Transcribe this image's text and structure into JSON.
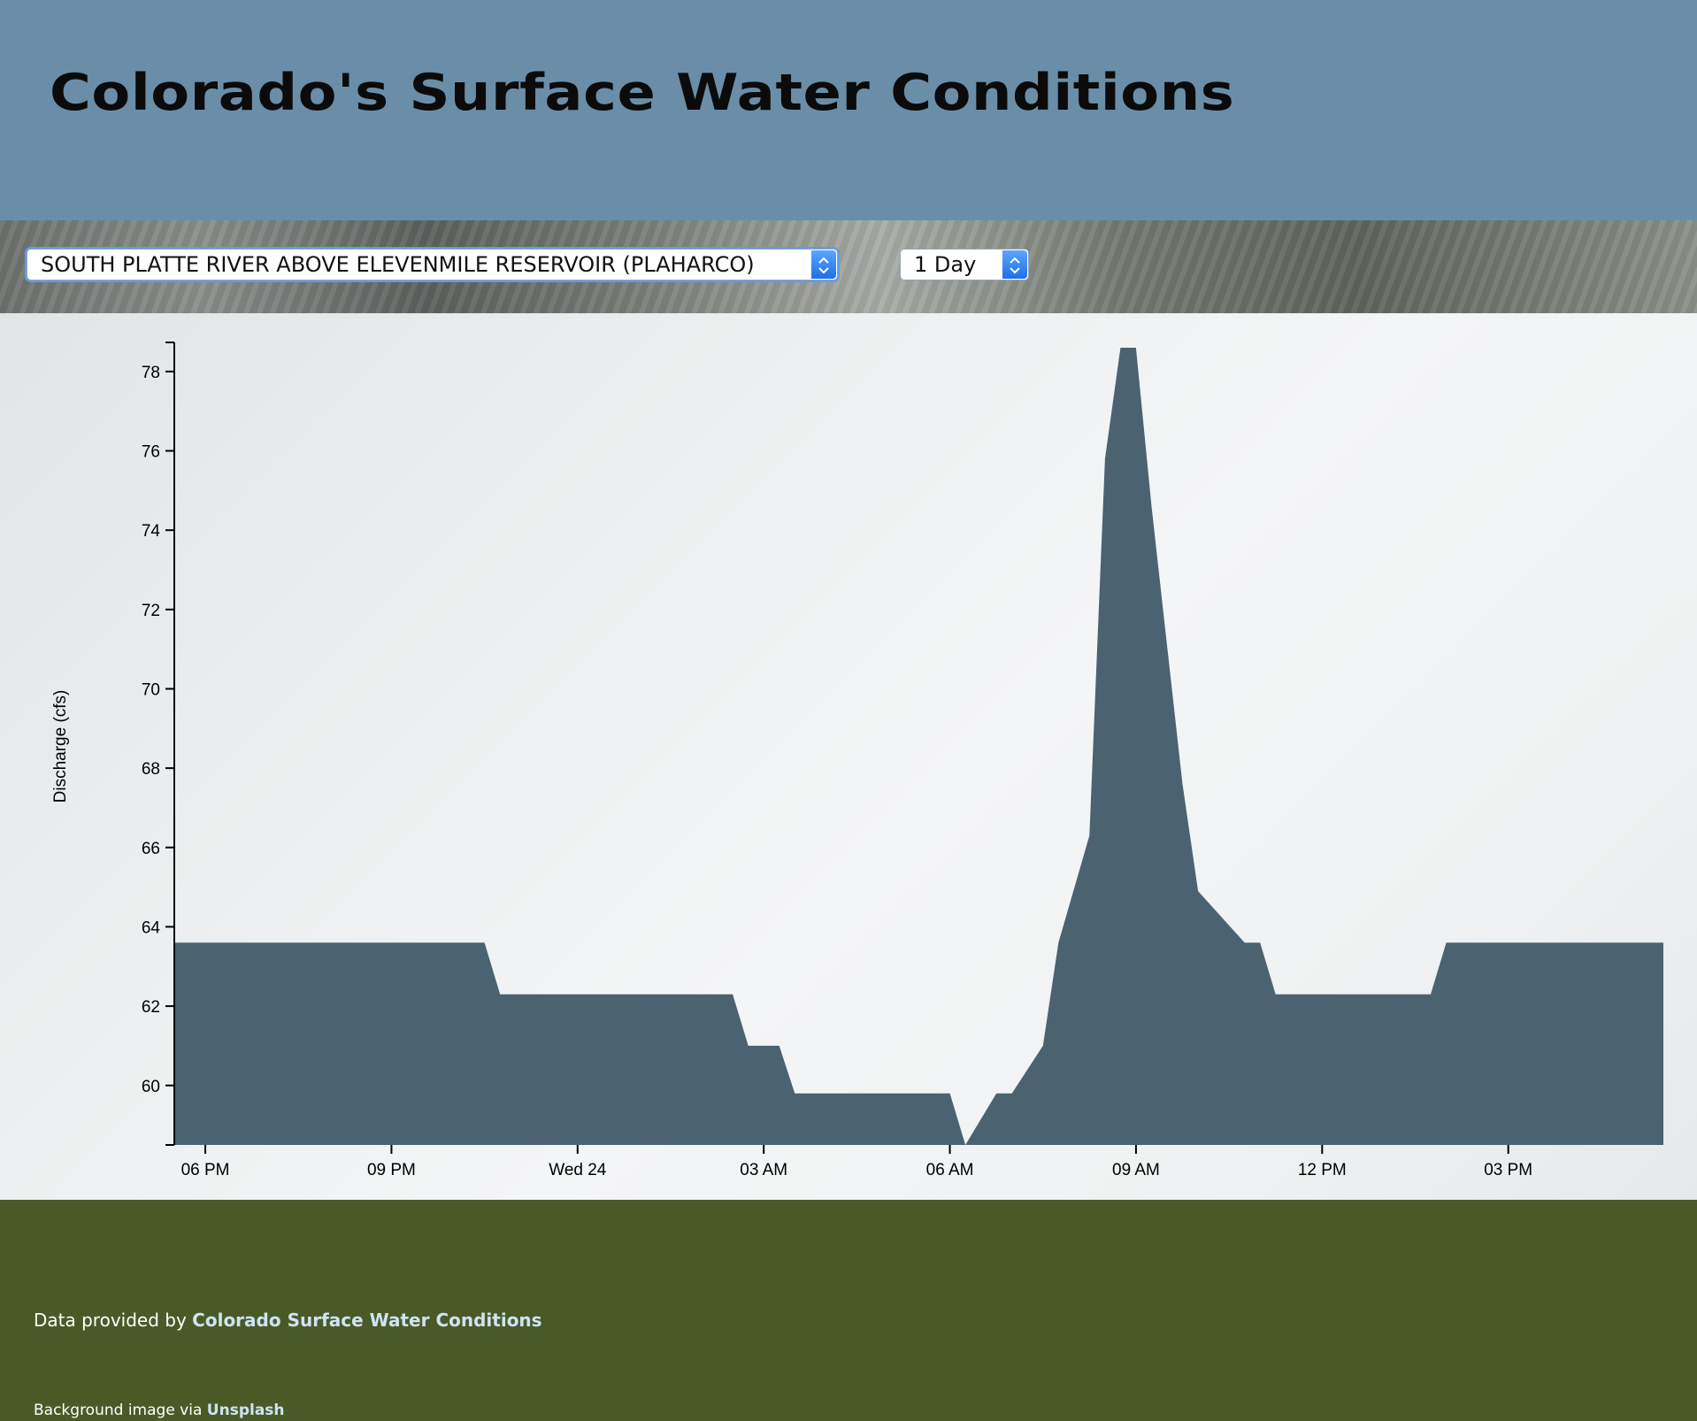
{
  "header": {
    "title": "Colorado's Surface Water Conditions"
  },
  "controls": {
    "station_select": {
      "value": "SOUTH PLATTE RIVER ABOVE ELEVENMILE RESERVOIR (PLAHARCO)"
    },
    "range_select": {
      "value": "1 Day"
    },
    "accent_color": "#2478f0"
  },
  "chart_data": {
    "type": "area",
    "ylabel": "Discharge (cfs)",
    "xlabel": "",
    "x_ticks": [
      "06 PM",
      "09 PM",
      "Wed 24",
      "03 AM",
      "06 AM",
      "09 AM",
      "12 PM",
      "03 PM"
    ],
    "y_ticks": [
      60,
      62,
      64,
      66,
      68,
      70,
      72,
      74,
      76,
      78
    ],
    "xlim_hours": [
      -0.5,
      23.5
    ],
    "ylim": [
      58.5,
      78.6
    ],
    "fill_color": "#4b6271",
    "series": [
      {
        "x_hours": [
          -0.5,
          4.5,
          4.75,
          8.5,
          8.75,
          9.25,
          9.5,
          12.0,
          12.25,
          12.75,
          13.0,
          13.5,
          13.75,
          14.25,
          14.5,
          14.75,
          15.0,
          15.25,
          15.75,
          16.0,
          16.75,
          17.0,
          17.25,
          17.5,
          19.75,
          20.0,
          23.5
        ],
        "values": [
          63.6,
          63.6,
          62.3,
          62.3,
          61.0,
          61.0,
          59.8,
          59.8,
          58.5,
          59.8,
          59.8,
          61.0,
          63.6,
          66.3,
          75.8,
          78.6,
          78.6,
          74.6,
          67.6,
          64.9,
          63.6,
          63.6,
          62.3,
          62.3,
          62.3,
          63.6,
          63.6
        ]
      }
    ]
  },
  "footer": {
    "credit_prefix": "Data provided by ",
    "credit_link": "Colorado Surface Water Conditions",
    "bg_prefix": "Background image via ",
    "bg_link": "Unsplash"
  }
}
